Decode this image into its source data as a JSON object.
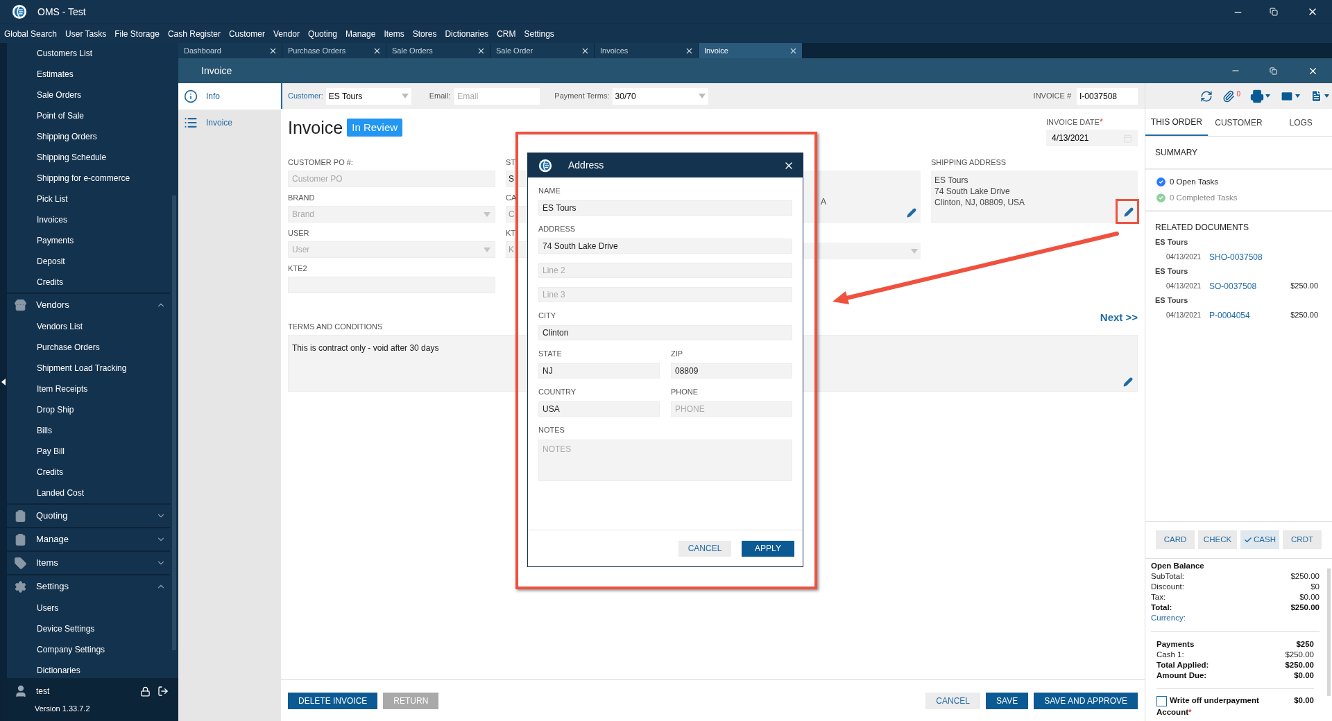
{
  "window": {
    "title": "OMS - Test"
  },
  "menu": [
    "Global Search",
    "User Tasks",
    "File Storage",
    "Cash Register",
    "Customer",
    "Vendor",
    "Quoting",
    "Manage",
    "Items",
    "Stores",
    "Dictionaries",
    "CRM",
    "Settings"
  ],
  "sidebar": {
    "sections": [
      {
        "items": [
          "Customers List",
          "Estimates",
          "Sale Orders",
          "Point of Sale",
          "Shipping Orders",
          "Shipping Schedule",
          "Shipping for e-commerce",
          "Pick List",
          "Invoices",
          "Payments",
          "Deposit",
          "Credits"
        ]
      },
      {
        "title": "Vendors",
        "expanded": true,
        "items": [
          "Vendors List",
          "Purchase Orders",
          "Shipment Load Tracking",
          "Item Receipts",
          "Drop Ship",
          "Bills",
          "Pay Bill",
          "Credits",
          "Landed Cost"
        ]
      },
      {
        "title": "Quoting",
        "expanded": false
      },
      {
        "title": "Manage",
        "expanded": false
      },
      {
        "title": "Items",
        "expanded": false
      },
      {
        "title": "Settings",
        "expanded": true,
        "items": [
          "Users",
          "Device Settings",
          "Company Settings",
          "Dictionaries"
        ]
      }
    ],
    "user": {
      "name": "test",
      "version": "Version 1.33.7.2"
    }
  },
  "tabs": [
    {
      "label": "Dashboard",
      "selected": false
    },
    {
      "label": "Purchase Orders",
      "selected": false
    },
    {
      "label": "Sale Orders",
      "selected": false
    },
    {
      "label": "Sale Order",
      "selected": false
    },
    {
      "label": "Invoices",
      "selected": false
    },
    {
      "label": "Invoice",
      "selected": true
    }
  ],
  "invoice_window": {
    "title": "Invoice",
    "nav": [
      {
        "label": "Info",
        "selected": true
      },
      {
        "label": "Invoice",
        "selected": false
      }
    ],
    "header_bar": {
      "customer": {
        "label": "Customer:",
        "value": "ES Tours"
      },
      "email": {
        "label": "Email:",
        "placeholder": "Email"
      },
      "payment_terms": {
        "label": "Payment Terms:",
        "value": "30/70"
      },
      "invoice_number": {
        "label": "INVOICE #",
        "value": "I-0037508"
      }
    },
    "heading": "Invoice",
    "status": "In Review",
    "invoice_date": {
      "label": "INVOICE DATE",
      "required_mark": "*",
      "value": "4/13/2021"
    },
    "fields": [
      {
        "label": "CUSTOMER PO #:",
        "placeholder": "Customer PO",
        "kind": "text"
      },
      {
        "label": "BRAND",
        "placeholder": "Brand",
        "kind": "select"
      },
      {
        "label": "USER",
        "placeholder": "User",
        "kind": "select"
      },
      {
        "label": "KTE2",
        "kind": "text"
      }
    ],
    "fields_column_2": [
      {
        "label": "ST",
        "value": "S"
      },
      {
        "label": "CA",
        "placeholder": "C"
      },
      {
        "label": "KT",
        "placeholder": "K"
      }
    ],
    "billing_address": {
      "lines": [
        "A"
      ]
    },
    "shipping_address": {
      "label": "SHIPPING ADDRESS",
      "lines": [
        "ES Tours",
        "74 South Lake Drive",
        "Clinton, NJ, 08809, USA"
      ]
    },
    "next": "Next >>",
    "terms": {
      "label": "TERMS AND CONDITIONS",
      "value": "This is contract only - void after 30 days"
    },
    "footer_left": [
      {
        "label": "DELETE INVOICE",
        "disabled": false
      },
      {
        "label": "RETURN",
        "disabled": true
      }
    ],
    "footer_right": [
      {
        "label": "CANCEL",
        "kind": "secondary"
      },
      {
        "label": "SAVE",
        "kind": "primary"
      },
      {
        "label": "SAVE AND APPROVE",
        "kind": "primary"
      }
    ]
  },
  "right_panel": {
    "attachments_count": "0",
    "tabs": [
      {
        "label": "THIS ORDER",
        "selected": true
      },
      {
        "label": "CUSTOMER",
        "selected": false
      },
      {
        "label": "LOGS",
        "selected": false
      }
    ],
    "summary": {
      "title": "SUMMARY",
      "tasks": [
        {
          "label": "0 Open Tasks",
          "kind": "open"
        },
        {
          "label": "0 Completed Tasks",
          "kind": "completed"
        }
      ]
    },
    "related": {
      "title": "RELATED DOCUMENTS",
      "documents": [
        {
          "name": "ES Tours",
          "date": "04/13/2021",
          "number": "SHO-0037508"
        },
        {
          "name": "ES Tours",
          "date": "04/13/2021",
          "number": "SO-0037508",
          "amount": "$250.00"
        },
        {
          "name": "ES Tours",
          "date": "04/13/2021",
          "number": "P-0004054",
          "amount": "$250.00"
        }
      ]
    },
    "payment_methods": [
      {
        "label": "CARD",
        "selected": false
      },
      {
        "label": "CHECK",
        "selected": false
      },
      {
        "label": "CASH",
        "selected": true
      },
      {
        "label": "CRDT",
        "selected": false
      }
    ],
    "balance": [
      {
        "label": "Open Balance",
        "kind": "bold"
      },
      {
        "label": "SubTotal:",
        "value": "$250.00",
        "kind": "normal"
      },
      {
        "label": "Discount:",
        "value": "$0",
        "kind": "normal"
      },
      {
        "label": "Tax:",
        "value": "$0.00",
        "kind": "normal"
      },
      {
        "label": "Total:",
        "value": "$250.00",
        "kind": "bold"
      },
      {
        "label": "Currency:",
        "kind": "link"
      }
    ],
    "payments": [
      {
        "label": "Payments",
        "value": "$250",
        "kind": "bold"
      },
      {
        "label": "Cash 1:",
        "value": "$250.00",
        "kind": "normal"
      },
      {
        "label": "Total Applied:",
        "value": "$250.00",
        "kind": "bold"
      },
      {
        "label": "Amount Due:",
        "value": "$0.00",
        "kind": "bold"
      }
    ],
    "write_off": {
      "label": "Write off underpayment",
      "checked": false,
      "value": "$0.00"
    },
    "account": {
      "label": "Account",
      "required_mark": "*"
    }
  },
  "address_dialog": {
    "title": "Address",
    "fields": [
      {
        "label": "NAME",
        "value": "ES Tours",
        "kind": "full"
      },
      {
        "label": "ADDRESS",
        "value": "74 South Lake Drive",
        "kind": "full"
      },
      {
        "placeholder": "Line 2",
        "kind": "full"
      },
      {
        "placeholder": "Line 3",
        "kind": "full"
      },
      {
        "label": "CITY",
        "value": "Clinton",
        "kind": "full"
      },
      {
        "label": "STATE",
        "value": "NJ",
        "kind": "half"
      },
      {
        "label": "ZIP",
        "value": "08809",
        "kind": "half"
      },
      {
        "label": "COUNTRY",
        "value": "USA",
        "kind": "half"
      },
      {
        "label": "PHONE",
        "placeholder": "PHONE",
        "kind": "half"
      },
      {
        "label": "NOTES",
        "placeholder": "NOTES",
        "kind": "notes"
      }
    ],
    "buttons": [
      {
        "label": "CANCEL",
        "kind": "secondary"
      },
      {
        "label": "APPLY",
        "kind": "primary"
      }
    ]
  }
}
